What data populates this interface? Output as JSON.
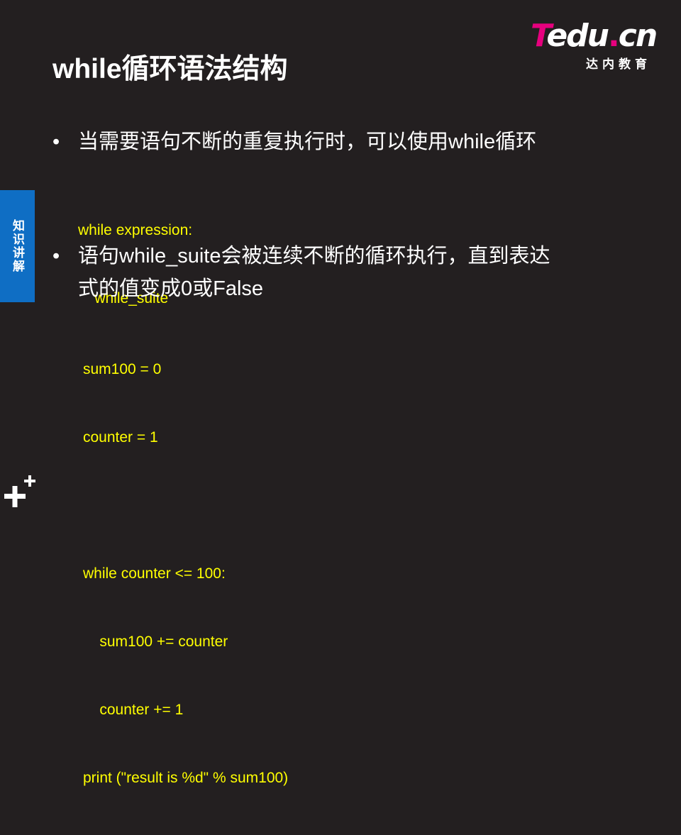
{
  "logo": {
    "word_t": "T",
    "word_rest": "edu",
    "word_dot": ".",
    "word_cn": "cn",
    "subtitle": "达内教育"
  },
  "slide": {
    "title": "while循环语法结构",
    "side_tab": "知识讲解",
    "bullets": [
      {
        "marker": "•",
        "lines": [
          "当需要语句不断的重复执行时，可以使用while循环"
        ]
      },
      {
        "marker": "•",
        "lines": [
          "语句while_suite会被连续不断的循环执行，直到表达",
          "式的值变成0或False"
        ]
      }
    ],
    "code_block_1": [
      "while expression:",
      "    while_suite"
    ],
    "code_block_2": [
      "sum100 = 0",
      "counter = 1",
      "",
      "while counter <= 100:",
      "    sum100 += counter",
      "    counter += 1",
      "print (\"result is %d\" % sum100)"
    ]
  },
  "colors": {
    "background": "#231f20",
    "code": "#ffff00",
    "tab": "#0f6ec4",
    "brand_magenta": "#e6007e"
  },
  "icons": {
    "corner": "plus-plus-icon"
  }
}
